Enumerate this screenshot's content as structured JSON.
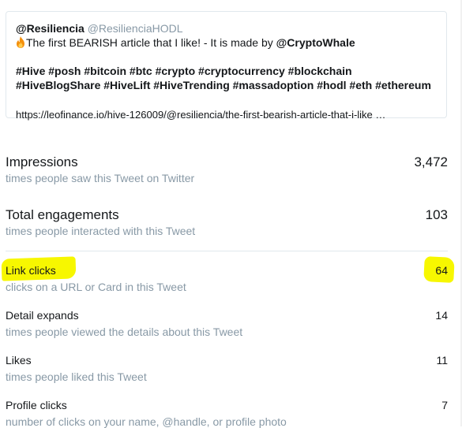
{
  "tweet": {
    "author_name": "@Resiliencia",
    "author_handle": "@ResilienciaHODL",
    "line1_prefix": "The first BEARISH article that I like! - It is made by ",
    "line1_mention": "@CryptoWhale",
    "hashtags_line1": "#Hive #posh #bitcoin #btc #crypto #cryptocurrency #blockchain",
    "hashtags_line2": "#HiveBlogShare #HiveLift #HiveTrending  #massadoption #hodl #eth #ethereum",
    "link": "https://leofinance.io/hive-126009/@resiliencia/the-first-bearish-article-that-i-like …",
    "icon": "fire-icon"
  },
  "metrics": {
    "impressions": {
      "title": "Impressions",
      "desc": "times people saw this Tweet on Twitter",
      "value": "3,472"
    },
    "engagements": {
      "title": "Total engagements",
      "desc": "times people interacted with this Tweet",
      "value": "103"
    },
    "link_clicks": {
      "title": "Link clicks",
      "desc": "clicks on a URL or Card in this Tweet",
      "value": "64"
    },
    "detail_expands": {
      "title": "Detail expands",
      "desc": "times people viewed the details about this Tweet",
      "value": "14"
    },
    "likes": {
      "title": "Likes",
      "desc": "times people liked this Tweet",
      "value": "11"
    },
    "profile_clicks": {
      "title": "Profile clicks",
      "desc": "number of clicks on your name, @handle, or profile photo",
      "value": "7"
    }
  },
  "colors": {
    "highlight": "#f7f700",
    "muted_text": "#8899a6",
    "primary_text": "#14171a",
    "border": "#e1e8ed"
  }
}
